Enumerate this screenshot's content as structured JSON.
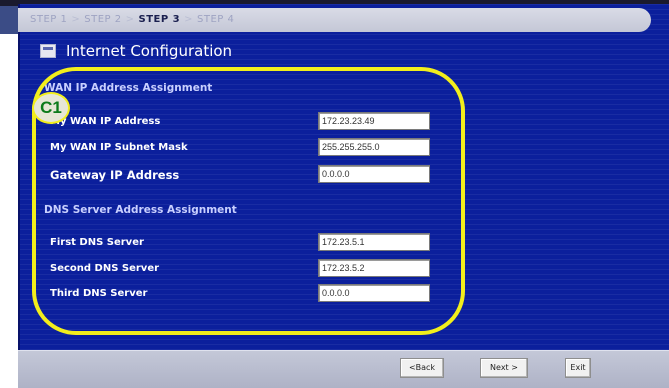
{
  "steps": [
    {
      "label": "STEP 1"
    },
    {
      "label": "STEP 2"
    },
    {
      "label": "STEP 3"
    },
    {
      "label": "STEP 4"
    }
  ],
  "step_separator": ">",
  "page_title": "Internet Configuration",
  "callout_badge": "C1",
  "wan": {
    "section_title": "WAN IP Address Assignment",
    "fields": [
      {
        "label": "My WAN IP Address",
        "value": "172.23.23.49"
      },
      {
        "label": "My WAN IP Subnet Mask",
        "value": "255.255.255.0"
      },
      {
        "label": "Gateway IP Address",
        "value": "0.0.0.0"
      }
    ]
  },
  "dns": {
    "section_title": "DNS Server Address Assignment",
    "fields": [
      {
        "label": "First DNS Server",
        "value": "172.23.5.1"
      },
      {
        "label": "Second DNS Server",
        "value": "172.23.5.2"
      },
      {
        "label": "Third DNS Server",
        "value": "0.0.0.0"
      }
    ]
  },
  "buttons": {
    "back": "<Back",
    "next": "Next >",
    "exit": "Exit"
  },
  "colors": {
    "panel_blue": "#0b1f9c",
    "callout_yellow": "#f2ee1c",
    "badge_green": "#0c7a1a"
  }
}
